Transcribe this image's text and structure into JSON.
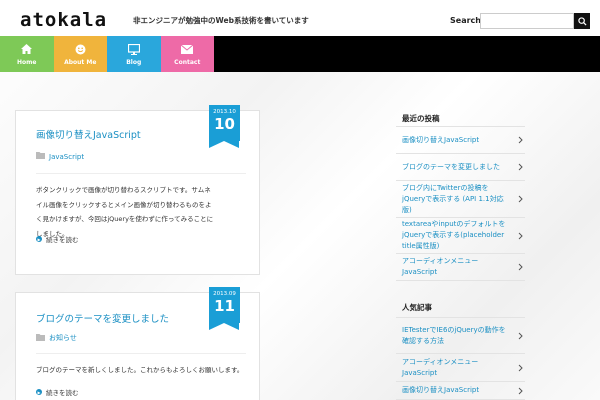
{
  "header": {
    "logo": "atokala",
    "tagline": "非エンジニアが勉強中のWeb系技術を書いています",
    "search_label": "Search",
    "search_value": ""
  },
  "nav": {
    "items": [
      {
        "label": "Home",
        "icon": "home-icon",
        "color": "#7ec957"
      },
      {
        "label": "About Me",
        "icon": "smiley-icon",
        "color": "#f0b43c"
      },
      {
        "label": "Blog",
        "icon": "monitor-icon",
        "color": "#2aa7dc"
      },
      {
        "label": "Contact",
        "icon": "envelope-icon",
        "color": "#ee6aa7"
      }
    ]
  },
  "posts": [
    {
      "title": "画像切り替えJavaScript",
      "category": "JavaScript",
      "excerpt": "ボタンクリックで画像が切り替わるスクリプトです。サムネイル画像をクリックするとメイン画像が切り替わるものをよく見かけますが、今回はjQueryを使わずに作ってみることにしました。",
      "read_more": "続きを読む",
      "date_ym": "2013.10",
      "date_day": "10"
    },
    {
      "title": "ブログのテーマを変更しました",
      "category": "お知らせ",
      "excerpt": "ブログのテーマを新しくしました。これからもよろしくお願いします。",
      "read_more": "続きを読む",
      "date_ym": "2013.09",
      "date_day": "11"
    }
  ],
  "sidebar": {
    "recent_heading": "最近の投稿",
    "recent": [
      "画像切り替えJavaScript",
      "ブログのテーマを変更しました",
      "ブログ内にTwitterの投稿をjQueryで表示する (API 1.1対応版)",
      "textareaやinputのデフォルトをjQueryで表示する(placeholder title属性版)",
      "アコーディオンメニューJavaScript"
    ],
    "popular_heading": "人気記事",
    "popular": [
      "IETesterでIE6のjQueryの動作を確認する方法",
      "アコーディオンメニューJavaScript",
      "画像切り替えJavaScript"
    ]
  },
  "colors": {
    "accent": "#1a9ed6",
    "link": "#1a8fc3"
  }
}
